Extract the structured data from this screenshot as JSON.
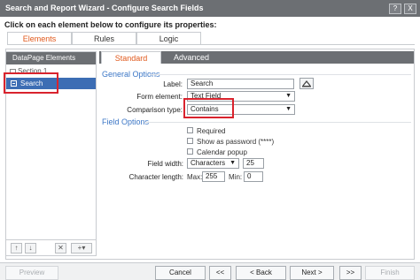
{
  "window": {
    "title": "Search and Report Wizard - Configure Search Fields",
    "buttons": {
      "help": "?",
      "close": "X"
    }
  },
  "instruction": "Click on each element below to configure its properties:",
  "tabs": [
    {
      "label": "Elements",
      "active": true
    },
    {
      "label": "Rules",
      "active": false
    },
    {
      "label": "Logic",
      "active": false
    }
  ],
  "left_panel": {
    "header": "DataPage Elements",
    "section": "Section 1",
    "selected_item": "Search",
    "toolbar": {
      "up": "↑",
      "down": "↓",
      "delete": "✕",
      "add": "+▾"
    }
  },
  "right_tabs": [
    {
      "label": "Standard",
      "active": true
    },
    {
      "label": "Advanced",
      "active": false
    }
  ],
  "general_options": {
    "title": "General Options",
    "label_label": "Label:",
    "label_value": "Search",
    "form_element_label": "Form element:",
    "form_element_value": "Text Field",
    "comparison_label": "Comparison type:",
    "comparison_value": "Contains"
  },
  "field_options": {
    "title": "Field Options",
    "required": {
      "label": "Required",
      "checked": false
    },
    "show_as_password": {
      "label": "Show as password (****)",
      "checked": false
    },
    "calendar_popup": {
      "label": "Calendar popup",
      "checked": false
    },
    "field_width_label": "Field width:",
    "field_width_unit": "Characters",
    "field_width_value": "25",
    "char_length_label": "Character length:",
    "max_label": "Max:",
    "max_value": "255",
    "min_label": "Min:",
    "min_value": "0"
  },
  "bottom_buttons": {
    "preview": "Preview",
    "cancel": "Cancel",
    "first": "<<",
    "back": "< Back",
    "next": "Next >",
    "last": ">>",
    "finish": "Finish"
  },
  "colors": {
    "titlebar": "#6c6f73",
    "accent_tab": "#e0581b",
    "section_title": "#3c77c6",
    "selection": "#3c6db4",
    "highlight_box": "#d9232d"
  }
}
